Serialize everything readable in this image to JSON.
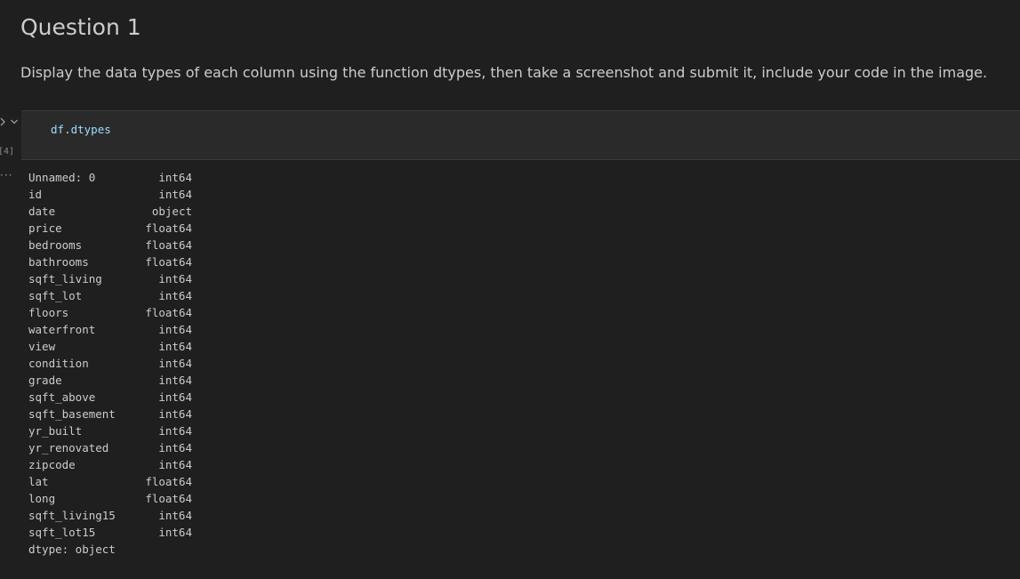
{
  "markdown": {
    "heading": "Question 1",
    "paragraph": "Display the data types of each column using the function dtypes, then take a screenshot and submit it, include your code in the image."
  },
  "code_cell": {
    "execution_count": "[4]",
    "code_var": "df",
    "code_dot": ".",
    "code_attr": "dtypes"
  },
  "output": {
    "menu_glyph": "···",
    "rows": [
      {
        "name": "Unnamed: 0",
        "type": "int64"
      },
      {
        "name": "id",
        "type": "int64"
      },
      {
        "name": "date",
        "type": "object"
      },
      {
        "name": "price",
        "type": "float64"
      },
      {
        "name": "bedrooms",
        "type": "float64"
      },
      {
        "name": "bathrooms",
        "type": "float64"
      },
      {
        "name": "sqft_living",
        "type": "int64"
      },
      {
        "name": "sqft_lot",
        "type": "int64"
      },
      {
        "name": "floors",
        "type": "float64"
      },
      {
        "name": "waterfront",
        "type": "int64"
      },
      {
        "name": "view",
        "type": "int64"
      },
      {
        "name": "condition",
        "type": "int64"
      },
      {
        "name": "grade",
        "type": "int64"
      },
      {
        "name": "sqft_above",
        "type": "int64"
      },
      {
        "name": "sqft_basement",
        "type": "int64"
      },
      {
        "name": "yr_built",
        "type": "int64"
      },
      {
        "name": "yr_renovated",
        "type": "int64"
      },
      {
        "name": "zipcode",
        "type": "int64"
      },
      {
        "name": "lat",
        "type": "float64"
      },
      {
        "name": "long",
        "type": "float64"
      },
      {
        "name": "sqft_living15",
        "type": "int64"
      },
      {
        "name": "sqft_lot15",
        "type": "int64"
      }
    ],
    "footer": "dtype: object"
  },
  "icons": {
    "run": "chevron-right-icon",
    "collapse": "chevron-down-icon",
    "more": "more-actions-icon"
  },
  "colors": {
    "background": "#1f1f1f",
    "cell_background": "#2a2a2a",
    "text": "#cccccc",
    "variable": "#9cdcfe"
  }
}
